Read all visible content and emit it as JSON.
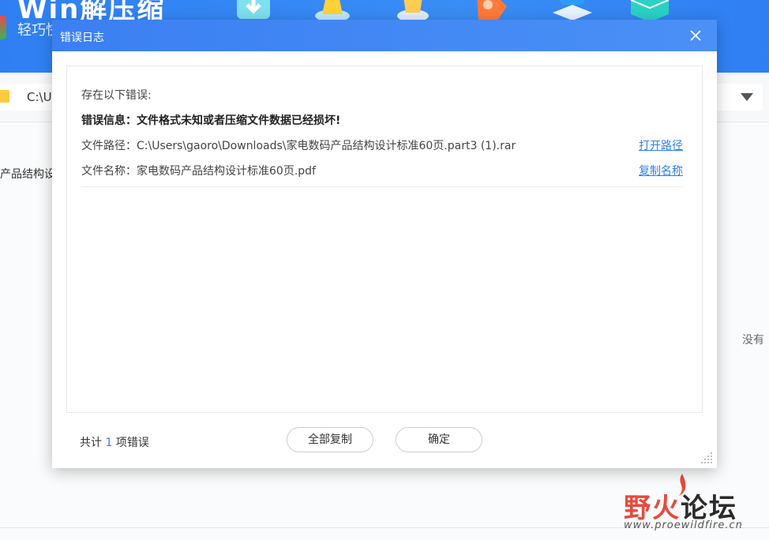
{
  "background_app": {
    "title": "Win解压缩",
    "subtitle": "轻巧快",
    "tool_icons": [
      "download-icon",
      "cone-icon",
      "cup-icon",
      "puzzle-icon",
      "stack-icon",
      "cube-icon"
    ],
    "path_value": "C:\\U",
    "file_name_partial": "产品结构设",
    "empty_hint": "没有"
  },
  "dialog": {
    "title": "错误日志",
    "heading": "存在以下错误:",
    "error_message": "错误信息：文件格式未知或者压缩文件数据已经损坏!",
    "path_label": "文件路径：",
    "path_value": "C:\\Users\\gaoro\\Downloads\\家电数码产品结构设计标准60页.part3 (1).rar",
    "open_path_label": "打开路径",
    "name_label": "文件名称：",
    "name_value": "家电数码产品结构设计标准60页.pdf",
    "copy_name_label": "复制名称",
    "summary_prefix": "共计",
    "error_count": "1",
    "summary_suffix": "项错误",
    "copy_all_label": "全部复制",
    "ok_label": "确定"
  },
  "watermark": {
    "text_red": "野火",
    "text_dark": "论坛",
    "url": "www.proewildfire.cn"
  },
  "colors": {
    "accent": "#2f7ff3",
    "titlebar": "#3b7ff2",
    "link": "#2f7ff3"
  }
}
